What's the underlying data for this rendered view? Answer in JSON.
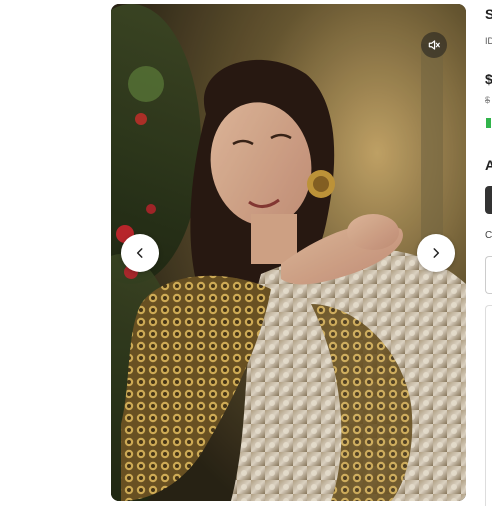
{
  "product": {
    "title": "S",
    "sku_label": "ID",
    "price": "$",
    "mrp": "$",
    "section_heading": "A",
    "field_label": "C"
  },
  "gallery": {
    "prev_icon": "chevron-left-icon",
    "next_icon": "chevron-right-icon",
    "mute_icon": "speaker-muted-icon"
  },
  "colors": {
    "stock_indicator": "#31b44b",
    "nav_button_bg": "#ffffff"
  }
}
